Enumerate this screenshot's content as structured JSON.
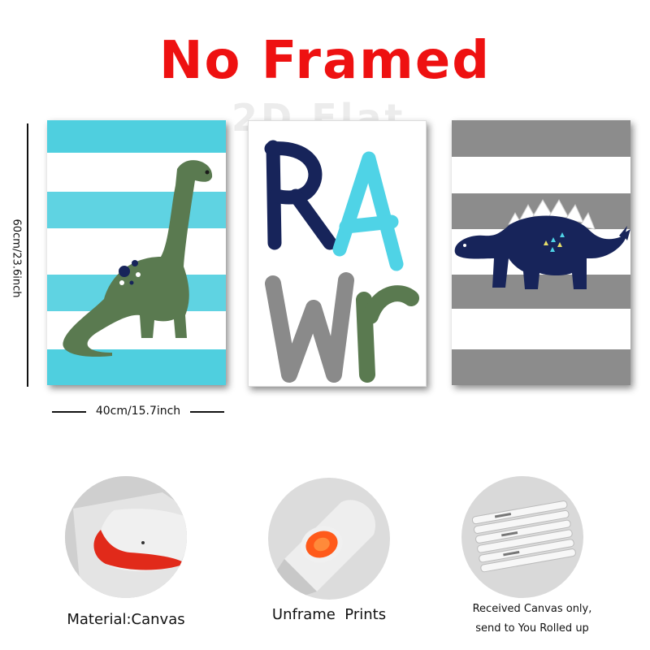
{
  "title": "No Framed",
  "watermark": "2D Flat",
  "dimensions": {
    "height_label": "60cm/23.6inch",
    "width_label": "40cm/15.7inch"
  },
  "posters": {
    "left": {
      "subject": "green brontosaurus on turquoise stripes",
      "stripe_color": "#4fcfdf",
      "dino_color": "#5a7a50"
    },
    "middle": {
      "letters": [
        "R",
        "A",
        "W",
        "r"
      ],
      "letter_colors": [
        "#17245a",
        "#4fd3e6",
        "#8a8a8a",
        "#5a7a50"
      ]
    },
    "right": {
      "subject": "navy stegosaurus on gray stripes",
      "stripe_color": "#8c8c8c",
      "dino_color": "#17245a"
    }
  },
  "features": [
    {
      "caption": "Material:Canvas",
      "icon": "canvas-roll-corner-icon"
    },
    {
      "caption": "Unframe  Prints",
      "icon": "canvas-roll-end-icon"
    },
    {
      "caption_line1": "Received Canvas only,",
      "caption_line2": "send to You Rolled up",
      "icon": "rolled-canvases-icon"
    }
  ]
}
